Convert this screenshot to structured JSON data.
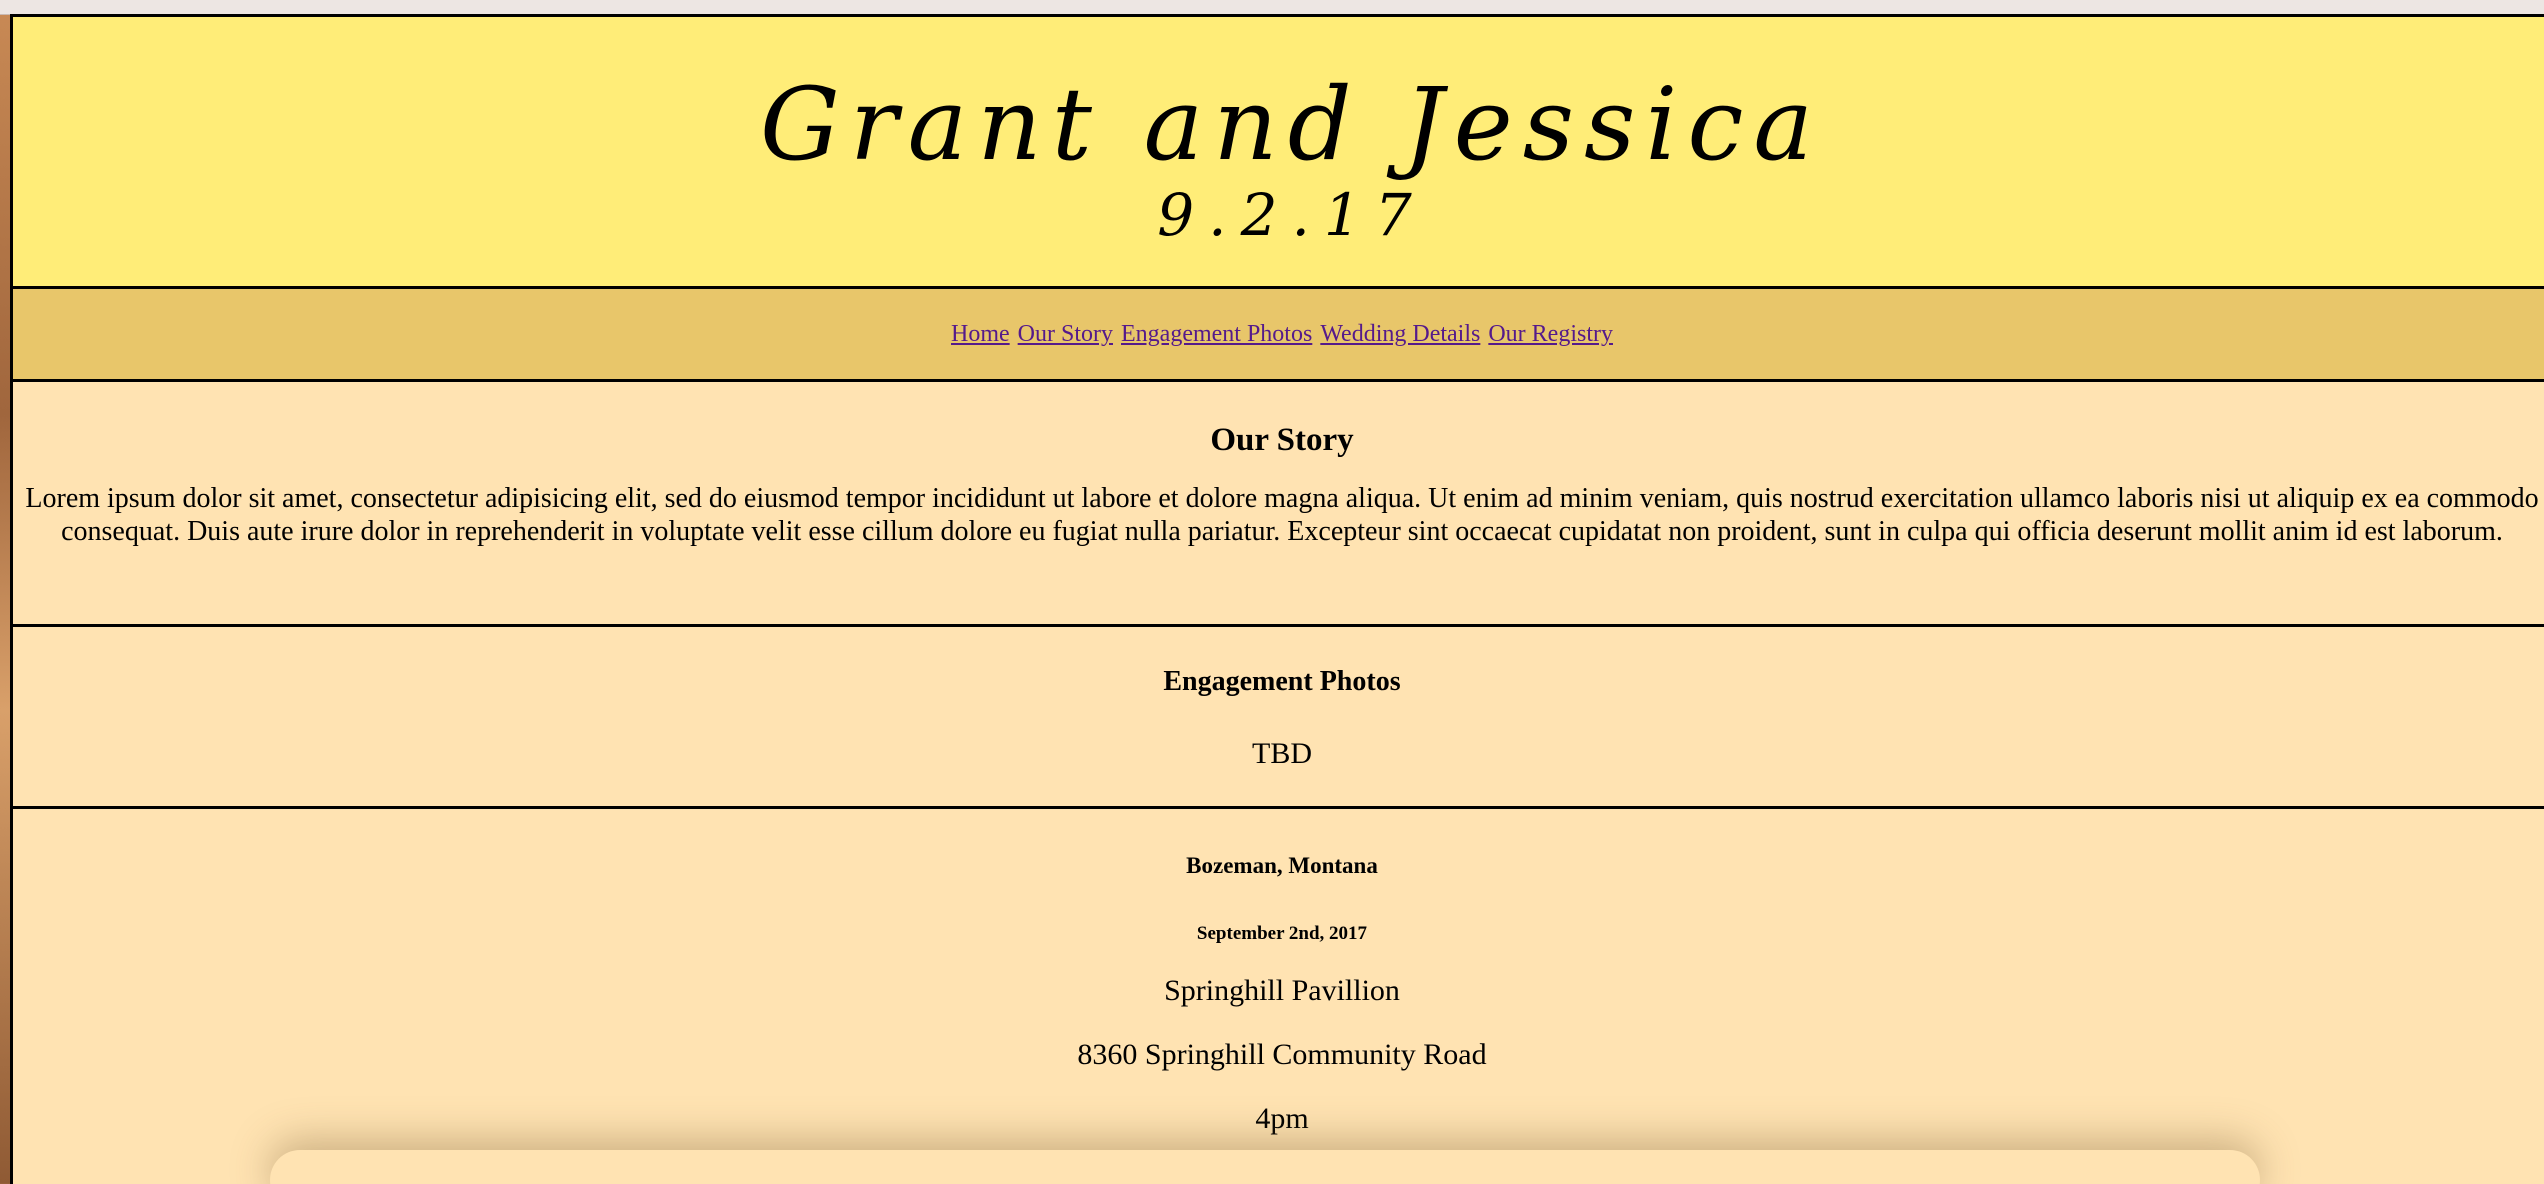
{
  "header": {
    "couple_names": "Grant and Jessica",
    "wedding_date_short": "9.2.17"
  },
  "nav": {
    "items": [
      {
        "label": "Home"
      },
      {
        "label": "Our Story"
      },
      {
        "label": "Engagement Photos"
      },
      {
        "label": "Wedding Details"
      },
      {
        "label": "Our Registry"
      }
    ]
  },
  "story": {
    "title": "Our Story",
    "body": "Lorem ipsum dolor sit amet, consectetur adipisicing elit, sed do eiusmod tempor incididunt ut labore et dolore magna aliqua. Ut enim ad minim veniam, quis nostrud exercitation ullamco laboris nisi ut aliquip ex ea commodo consequat. Duis aute irure dolor in reprehenderit in voluptate velit esse cillum dolore eu fugiat nulla pariatur. Excepteur sint occaecat cupidatat non proident, sunt in culpa qui officia deserunt mollit anim id est laborum."
  },
  "photos": {
    "title": "Engagement Photos",
    "status": "TBD"
  },
  "details": {
    "location": "Bozeman, Montana",
    "date": "September 2nd, 2017",
    "venue": "Springhill Pavillion",
    "address": "8360 Springhill Community Road",
    "time": "4pm"
  },
  "colors": {
    "header_bg": "#ffed78",
    "nav_bg": "#e8c66a",
    "content_bg": "#ffe3b2",
    "link": "#551a8b"
  }
}
